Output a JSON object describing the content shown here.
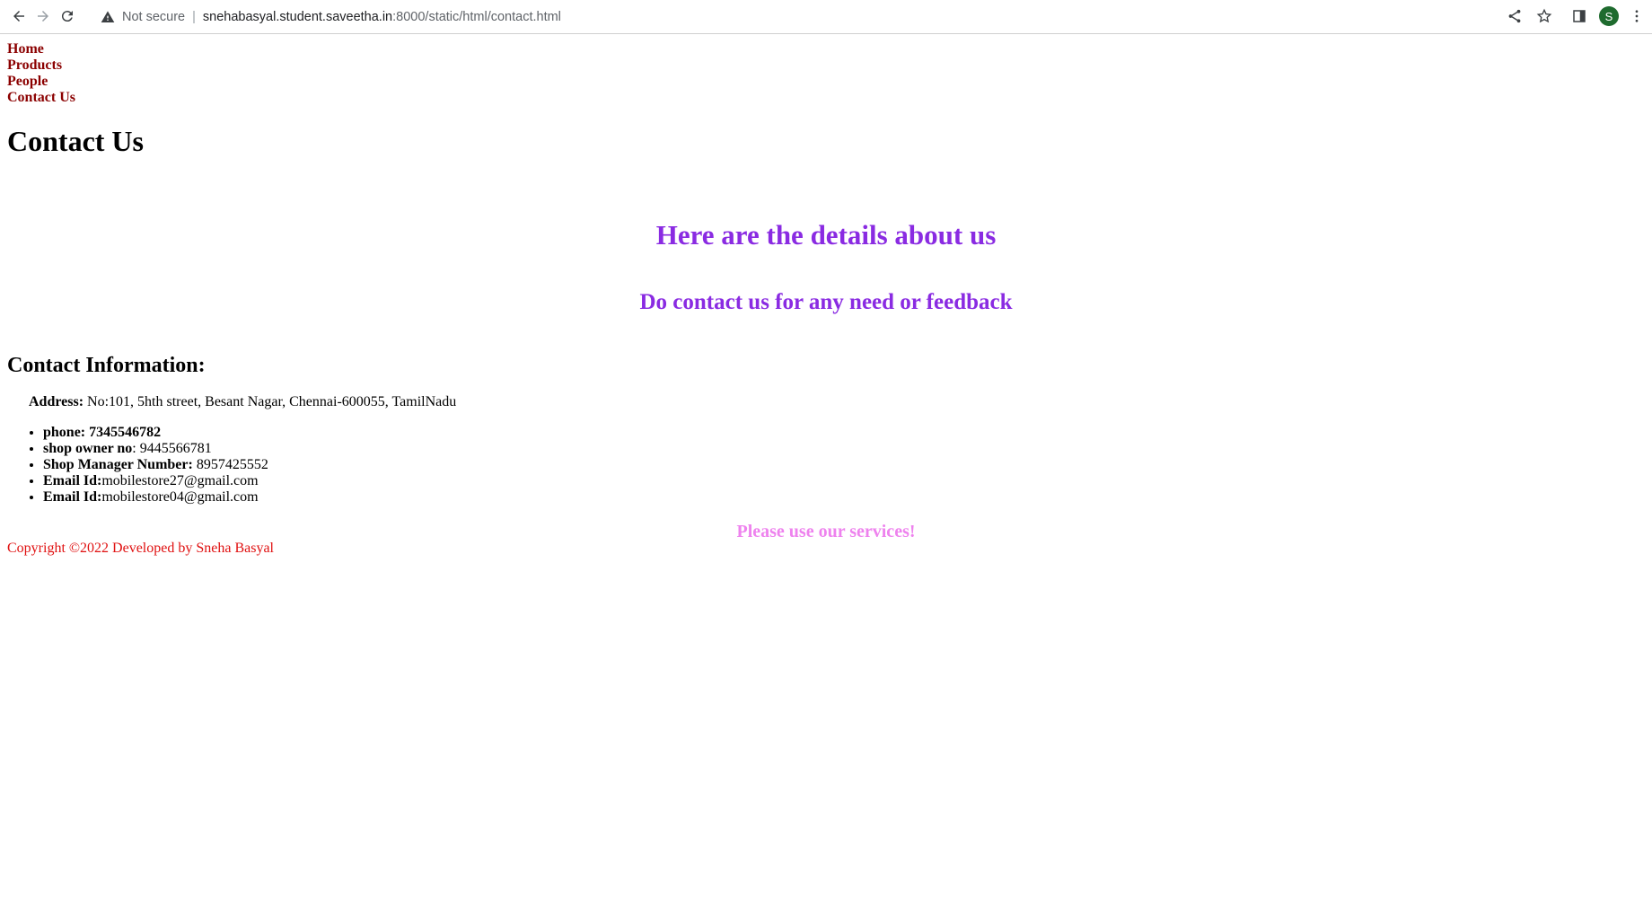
{
  "browser": {
    "security_label": "Not secure",
    "url_host": "snehabasyal.student.saveetha.in",
    "url_path": ":8000/static/html/contact.html",
    "profile_initial": "S"
  },
  "nav": {
    "items": [
      "Home",
      "Products",
      "People",
      "Contact Us"
    ]
  },
  "page": {
    "title": "Contact Us",
    "details_heading": "Here are the details about us",
    "contact_heading": "Do contact us for any need or feedback",
    "info_heading": "Contact Information:",
    "address_label": "Address:",
    "address_value": " No:101, 5hth street, Besant Nagar, Chennai-600055, TamilNadu",
    "list": [
      {
        "label": "phone: 7345546782",
        "value": ""
      },
      {
        "label": "shop owner no",
        "value": ": 9445566781"
      },
      {
        "label": "Shop Manager Number:",
        "value": " 8957425552"
      },
      {
        "label": "Email Id:",
        "value": "mobilestore27@gmail.com"
      },
      {
        "label": "Email Id:",
        "value": "mobilestore04@gmail.com"
      }
    ],
    "services": "Please use our services!",
    "footer": "Copyright ©2022 Developed by Sneha Basyal"
  },
  "colors": {
    "nav_link": "#8b0000",
    "heading_purple": "#8a2be2",
    "services_pink": "#ee82ee",
    "footer_red": "#e01010"
  }
}
